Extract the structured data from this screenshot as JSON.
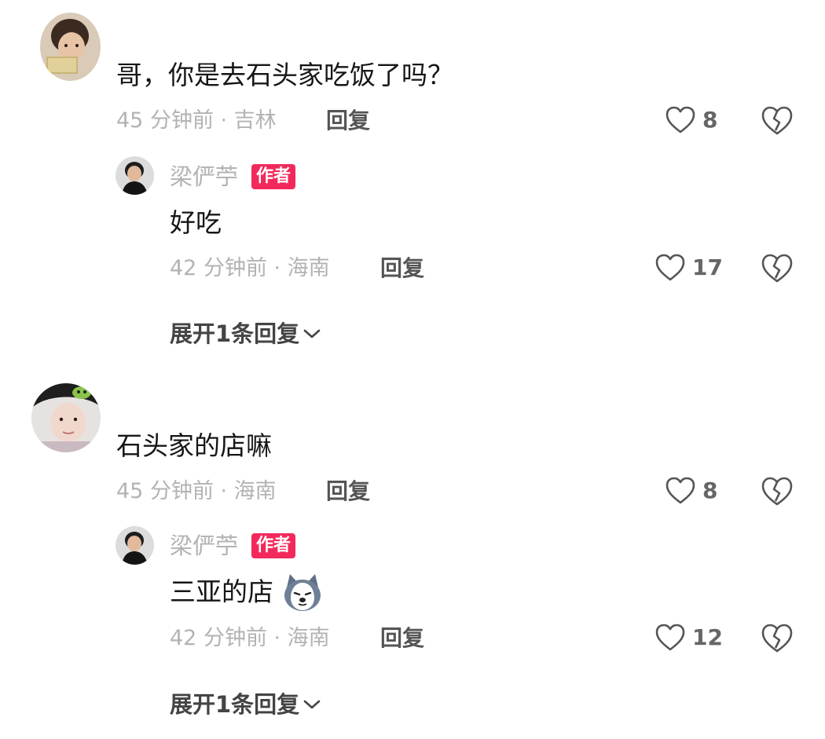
{
  "comments": [
    {
      "text": "哥，你是去石头家吃饭了吗？",
      "meta": "45 分钟前 · 吉林",
      "reply_label": "回复",
      "likes": "8",
      "author_reply": {
        "username": "梁俨苧",
        "badge": "作者",
        "text": "好吃",
        "meta": "42 分钟前 · 海南",
        "reply_label": "回复",
        "likes": "17"
      },
      "expand_label": "展开1条回复"
    },
    {
      "text": "石头家的店嘛",
      "meta": "45 分钟前 · 海南",
      "reply_label": "回复",
      "likes": "8",
      "author_reply": {
        "username": "梁俨苧",
        "badge": "作者",
        "text": "三亚的店",
        "emoji": "husky-emoji",
        "meta": "42 分钟前 · 海南",
        "reply_label": "回复",
        "likes": "12"
      },
      "expand_label": "展开1条回复"
    }
  ],
  "colors": {
    "badge": "#f2295a",
    "text": "#161616",
    "meta": "#b3b3b3"
  }
}
